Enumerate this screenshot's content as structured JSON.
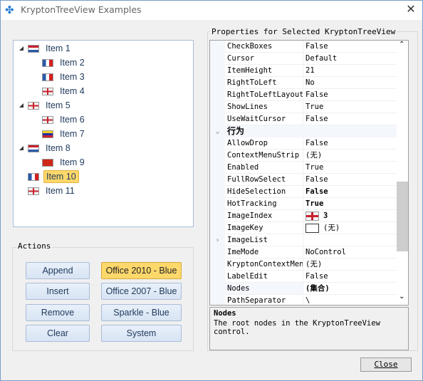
{
  "window": {
    "title": "KryptonTreeView Examples",
    "icon": "puzzle-icon",
    "close_icon": "close-icon"
  },
  "tree": {
    "nodes": [
      {
        "label": "Item 1",
        "level": 0,
        "expanded": true,
        "flag": "netherlands"
      },
      {
        "label": "Item 2",
        "level": 1,
        "flag": "france"
      },
      {
        "label": "Item 3",
        "level": 1,
        "flag": "france"
      },
      {
        "label": "Item 4",
        "level": 1,
        "flag": "england"
      },
      {
        "label": "Item 5",
        "level": 0,
        "expanded": true,
        "flag": "england"
      },
      {
        "label": "Item 6",
        "level": 1,
        "flag": "england"
      },
      {
        "label": "Item 7",
        "level": 1,
        "flag": "venezuela"
      },
      {
        "label": "Item 8",
        "level": 0,
        "expanded": true,
        "flag": "netherlands"
      },
      {
        "label": "Item 9",
        "level": 1,
        "flag": "china"
      },
      {
        "label": "Item 10",
        "level": 0,
        "flag": "france",
        "selected": true
      },
      {
        "label": "Item 11",
        "level": 0,
        "flag": "england"
      }
    ]
  },
  "actions": {
    "label": "Actions",
    "left_buttons": [
      "Append",
      "Insert",
      "Remove",
      "Clear"
    ],
    "right_buttons": [
      "Office 2010 - Blue",
      "Office 2007 - Blue",
      "Sparkle - Blue",
      "System"
    ],
    "active_theme": "Office 2010 - Blue"
  },
  "properties": {
    "label": "Properties for Selected KryptonTreeView",
    "rows": [
      {
        "name": "CheckBoxes",
        "value": "False"
      },
      {
        "name": "Cursor",
        "value": "Default"
      },
      {
        "name": "ItemHeight",
        "value": "21"
      },
      {
        "name": "RightToLeft",
        "value": "No"
      },
      {
        "name": "RightToLeftLayout",
        "value": "False"
      },
      {
        "name": "ShowLines",
        "value": "True"
      },
      {
        "name": "UseWaitCursor",
        "value": "False"
      },
      {
        "name": "行为",
        "category": true
      },
      {
        "name": "AllowDrop",
        "value": "False"
      },
      {
        "name": "ContextMenuStrip",
        "value": "(无)"
      },
      {
        "name": "Enabled",
        "value": "True"
      },
      {
        "name": "FullRowSelect",
        "value": "False"
      },
      {
        "name": "HideSelection",
        "value": "False",
        "bold": true
      },
      {
        "name": "HotTracking",
        "value": "True",
        "bold": true
      },
      {
        "name": "ImageIndex",
        "value": "3",
        "bold": true,
        "swatch": "england"
      },
      {
        "name": "ImageKey",
        "value": "(无)",
        "swatch": "empty"
      },
      {
        "name": "ImageList",
        "value": "",
        "expandable": true
      },
      {
        "name": "ImeMode",
        "value": "NoControl"
      },
      {
        "name": "KryptonContextMenu",
        "value": "(无)"
      },
      {
        "name": "LabelEdit",
        "value": "False"
      },
      {
        "name": "Nodes",
        "value": "(集合)",
        "bold": true,
        "selected": true
      },
      {
        "name": "PathSeparator",
        "value": "\\"
      }
    ]
  },
  "description": {
    "title": "Nodes",
    "text": "The root nodes in the KryptonTreeView control."
  },
  "close_button": "Close",
  "colors": {
    "selection": "#ffd86b",
    "button": "#dde8f6",
    "text": "#1e395b"
  }
}
